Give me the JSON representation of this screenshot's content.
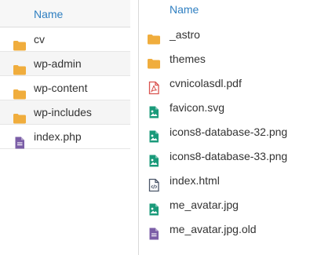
{
  "colors": {
    "header_text": "#2f7fc1",
    "folder": "#f0ad3d",
    "image": "#1a9a7a",
    "pdf": "#d9534f",
    "code": "#4a5568",
    "generic": "#7b5ea7"
  },
  "left_pane": {
    "header": "Name",
    "items": [
      {
        "name": "cv",
        "icon": "folder-icon"
      },
      {
        "name": "wp-admin",
        "icon": "folder-icon"
      },
      {
        "name": "wp-content",
        "icon": "folder-icon"
      },
      {
        "name": "wp-includes",
        "icon": "folder-icon"
      },
      {
        "name": "index.php",
        "icon": "file-icon"
      }
    ]
  },
  "right_pane": {
    "header": "Name",
    "items": [
      {
        "name": "_astro",
        "icon": "folder-icon"
      },
      {
        "name": "themes",
        "icon": "folder-icon"
      },
      {
        "name": "cvnicolasdl.pdf",
        "icon": "pdf-file-icon"
      },
      {
        "name": "favicon.svg",
        "icon": "image-file-icon"
      },
      {
        "name": "icons8-database-32.png",
        "icon": "image-file-icon"
      },
      {
        "name": "icons8-database-33.png",
        "icon": "image-file-icon"
      },
      {
        "name": "index.html",
        "icon": "code-file-icon"
      },
      {
        "name": "me_avatar.jpg",
        "icon": "image-file-icon"
      },
      {
        "name": "me_avatar.jpg.old",
        "icon": "file-icon"
      }
    ]
  }
}
